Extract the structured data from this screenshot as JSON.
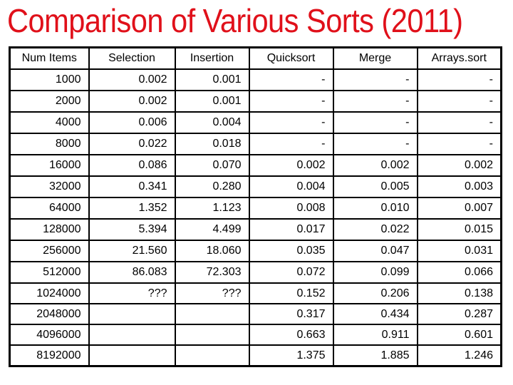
{
  "title": "Comparison of Various Sorts (2011)",
  "colors": {
    "title": "#e0101a",
    "text": "#000000",
    "grid": "#000000",
    "background": "#ffffff"
  },
  "table": {
    "columns": [
      "Num Items",
      "Selection",
      "Insertion",
      "Quicksort",
      "Merge",
      "Arrays.sort"
    ],
    "rows": [
      [
        "1000",
        "0.002",
        "0.001",
        "-",
        "-",
        "-"
      ],
      [
        "2000",
        "0.002",
        "0.001",
        "-",
        "-",
        "-"
      ],
      [
        "4000",
        "0.006",
        "0.004",
        "-",
        "-",
        "-"
      ],
      [
        "8000",
        "0.022",
        "0.018",
        "-",
        "-",
        "-"
      ],
      [
        "16000",
        "0.086",
        "0.070",
        "0.002",
        "0.002",
        "0.002"
      ],
      [
        "32000",
        "0.341",
        "0.280",
        "0.004",
        "0.005",
        "0.003"
      ],
      [
        "64000",
        "1.352",
        "1.123",
        "0.008",
        "0.010",
        "0.007"
      ],
      [
        "128000",
        "5.394",
        "4.499",
        "0.017",
        "0.022",
        "0.015"
      ],
      [
        "256000",
        "21.560",
        "18.060",
        "0.035",
        "0.047",
        "0.031"
      ],
      [
        "512000",
        "86.083",
        "72.303",
        "0.072",
        "0.099",
        "0.066"
      ],
      [
        "1024000",
        "???",
        "???",
        "0.152",
        "0.206",
        "0.138"
      ],
      [
        "2048000",
        "",
        "",
        "0.317",
        "0.434",
        "0.287"
      ],
      [
        "4096000",
        "",
        "",
        "0.663",
        "0.911",
        "0.601"
      ],
      [
        "8192000",
        "",
        "",
        "1.375",
        "1.885",
        "1.246"
      ]
    ]
  }
}
